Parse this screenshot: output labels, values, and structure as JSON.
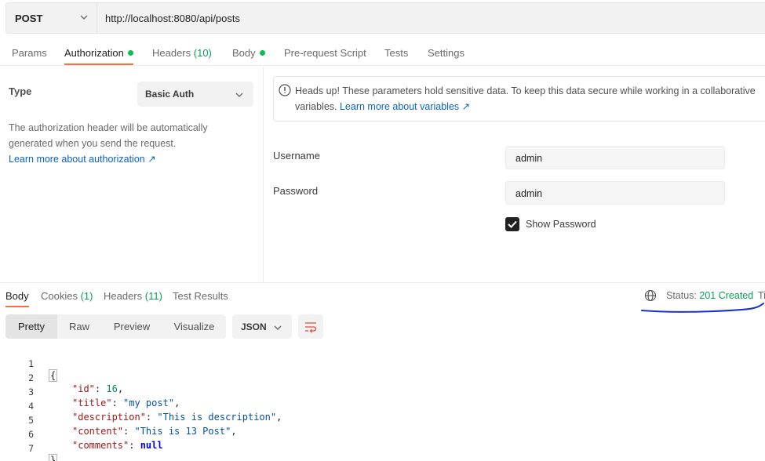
{
  "request": {
    "method": "POST",
    "url": "http://localhost:8080/api/posts"
  },
  "request_tabs": [
    {
      "label": "Params",
      "count": "",
      "dot": false,
      "active": false
    },
    {
      "label": "Authorization",
      "count": "",
      "dot": true,
      "active": true
    },
    {
      "label": "Headers",
      "count": "(10)",
      "dot": false,
      "active": false
    },
    {
      "label": "Body",
      "count": "",
      "dot": true,
      "active": false
    },
    {
      "label": "Pre-request Script",
      "count": "",
      "dot": false,
      "active": false
    },
    {
      "label": "Tests",
      "count": "",
      "dot": false,
      "active": false
    },
    {
      "label": "Settings",
      "count": "",
      "dot": false,
      "active": false
    }
  ],
  "auth": {
    "type_label": "Type",
    "type_value": "Basic Auth",
    "description": "The authorization header will be automatically generated when you send the request.",
    "learn_more": "Learn more about authorization ↗",
    "alert_line1": "Heads up! These parameters hold sensitive data. To keep this data secure while working in a collaborative",
    "alert_line2_prefix": "variables.",
    "alert_link": "Learn more about variables ↗",
    "username_label": "Username",
    "username_value": "admin",
    "password_label": "Password",
    "password_value": "admin",
    "show_password_label": "Show Password",
    "show_password_checked": true
  },
  "response_tabs": [
    {
      "label": "Body",
      "count": "",
      "active": true
    },
    {
      "label": "Cookies",
      "count": "(1)",
      "active": false
    },
    {
      "label": "Headers",
      "count": "(11)",
      "active": false
    },
    {
      "label": "Test Results",
      "count": "",
      "active": false
    }
  ],
  "response_status": {
    "label": "Status:",
    "value": "201 Created",
    "truncated_next": "Ti"
  },
  "view_modes": [
    "Pretty",
    "Raw",
    "Preview",
    "Visualize"
  ],
  "format": "JSON",
  "code_lines": [
    {
      "num": "1",
      "text": "{"
    },
    {
      "num": "2",
      "key": "\"id\"",
      "value": "16",
      "vtype": "n",
      "comma": ","
    },
    {
      "num": "3",
      "key": "\"title\"",
      "value": "\"my post\"",
      "vtype": "s",
      "comma": ","
    },
    {
      "num": "4",
      "key": "\"description\"",
      "value": "\"This is description\"",
      "vtype": "s",
      "comma": ","
    },
    {
      "num": "5",
      "key": "\"content\"",
      "value": "\"This is 13 Post\"",
      "vtype": "s",
      "comma": ","
    },
    {
      "num": "6",
      "key": "\"comments\"",
      "value": "null",
      "vtype": "nl",
      "comma": ""
    },
    {
      "num": "7",
      "text": "}"
    }
  ]
}
